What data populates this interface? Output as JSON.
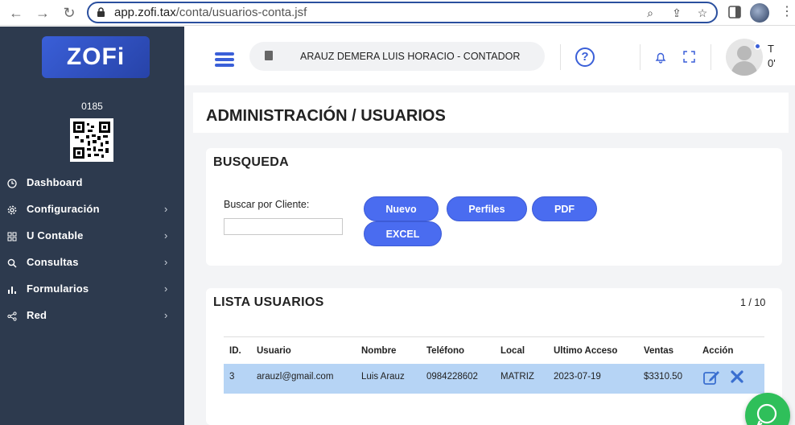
{
  "browser": {
    "url_domain": "app.zofi.tax",
    "url_path": "/conta/usuarios-conta.jsf"
  },
  "sidebar": {
    "logo_text": "ZOFi",
    "company_code": "0185",
    "items": [
      {
        "label": "Dashboard",
        "icon": "clock-icon",
        "has_submenu": false
      },
      {
        "label": "Configuración",
        "icon": "gear-icon",
        "has_submenu": true
      },
      {
        "label": "U Contable",
        "icon": "grid-icon",
        "has_submenu": true
      },
      {
        "label": "Consultas",
        "icon": "search-icon",
        "has_submenu": true
      },
      {
        "label": "Formularios",
        "icon": "bar-chart-icon",
        "has_submenu": true
      },
      {
        "label": "Red",
        "icon": "share-icon",
        "has_submenu": true
      }
    ]
  },
  "header": {
    "user_context": "ARAUZ DEMERA LUIS HORACIO - CONTADOR",
    "user_short_line1": "T",
    "user_short_line2": "0'"
  },
  "page": {
    "title": "ADMINISTRACIÓN / USUARIOS"
  },
  "search_card": {
    "title": "BUSQUEDA",
    "field_label": "Buscar por Cliente:",
    "field_value": "",
    "buttons": {
      "nuevo": "Nuevo",
      "perfiles": "Perfiles",
      "pdf": "PDF",
      "excel": "EXCEL"
    }
  },
  "list_card": {
    "title": "LISTA USUARIOS",
    "pager": "1 / 10",
    "columns": [
      "ID.",
      "Usuario",
      "Nombre",
      "Teléfono",
      "Local",
      "Ultimo Acceso",
      "Ventas",
      "Acción"
    ],
    "rows": [
      {
        "id": "3",
        "usuario": "arauzl@gmail.com",
        "nombre": "Luis Arauz",
        "telefono": "0984228602",
        "local": "MATRIZ",
        "ultimo_acceso": "2023-07-19",
        "ventas": "$3310.50"
      }
    ]
  },
  "colors": {
    "sidebar_bg": "#2d3a4e",
    "accent": "#4a6cf0",
    "row_highlight": "#b6d4f5",
    "whatsapp": "#2fbf5a"
  }
}
